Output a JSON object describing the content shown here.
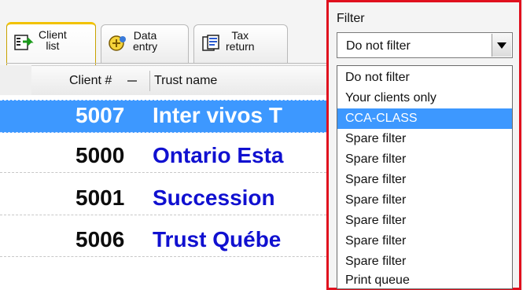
{
  "tabs": [
    {
      "label_line1": "Client",
      "label_line2": "list",
      "icon": "client-list-icon",
      "active": true
    },
    {
      "label_line1": "Data",
      "label_line2": "entry",
      "icon": "data-entry-icon",
      "active": false
    },
    {
      "label_line1": "Tax",
      "label_line2": "return",
      "icon": "tax-return-icon",
      "active": false
    }
  ],
  "table": {
    "headers": {
      "client_num": "Client #",
      "trust_name": "Trust name"
    },
    "rows": [
      {
        "client_num": "5007",
        "trust_name": "Inter vivos T",
        "selected": true
      },
      {
        "client_num": "5000",
        "trust_name": "Ontario Esta",
        "selected": false
      },
      {
        "client_num": "5001",
        "trust_name": "Succession",
        "selected": false
      },
      {
        "client_num": "5006",
        "trust_name": "Trust Québe",
        "selected": false
      }
    ]
  },
  "filter": {
    "label": "Filter",
    "selected_value": "Do not filter",
    "options": [
      "Do not filter",
      "Your clients only",
      "CCA-CLASS",
      "Spare filter",
      "Spare filter",
      "Spare filter",
      "Spare filter",
      "Spare filter",
      "Spare filter",
      "Spare filter",
      "Print queue"
    ],
    "highlighted_index": 2
  },
  "colors": {
    "selection": "#3d98ff",
    "name_text": "#1010d0",
    "highlight_border": "#e0101e"
  }
}
